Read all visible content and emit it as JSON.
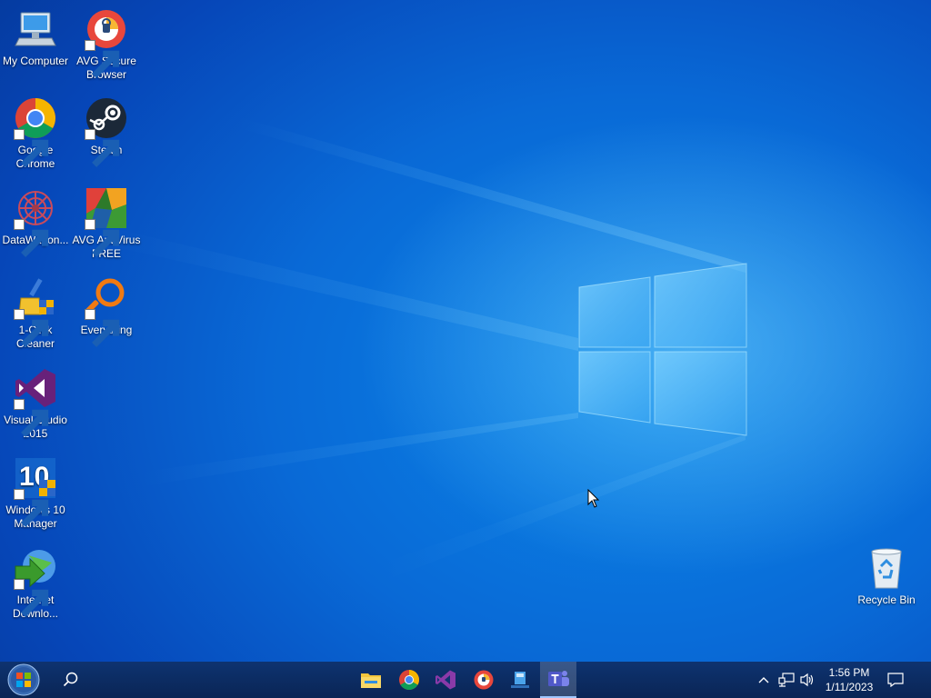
{
  "desktop": {
    "icons": [
      {
        "label": "My Computer",
        "icon": "computer-icon"
      },
      {
        "label": "AVG Secure Browser",
        "icon": "avg-secure-browser-icon"
      },
      {
        "label": "Google Chrome",
        "icon": "chrome-icon"
      },
      {
        "label": "Steam",
        "icon": "steam-icon"
      },
      {
        "label": "DataWagon...",
        "icon": "datawagon-icon"
      },
      {
        "label": "AVG AntiVirus FREE",
        "icon": "avg-antivirus-icon"
      },
      {
        "label": "1-Click Cleaner",
        "icon": "cleaner-icon"
      },
      {
        "label": "Everything",
        "icon": "everything-search-icon"
      },
      {
        "label": "Visual Studio 2015",
        "icon": "visual-studio-icon"
      },
      {
        "label": "Windows 10 Manager",
        "icon": "windows10-manager-icon"
      },
      {
        "label": "Internet Downlo...",
        "icon": "internet-download-manager-icon"
      },
      {
        "label": "Recycle Bin",
        "icon": "recycle-bin-icon"
      }
    ]
  },
  "taskbar": {
    "start": {
      "icon": "windows-start-orb-icon"
    },
    "search": {
      "icon": "search-icon"
    },
    "pinned": [
      {
        "name": "File Explorer",
        "icon": "folder-icon"
      },
      {
        "name": "Google Chrome",
        "icon": "chrome-icon"
      },
      {
        "name": "Visual Studio",
        "icon": "visual-studio-icon"
      },
      {
        "name": "AVG Secure Browser",
        "icon": "avg-secure-browser-icon"
      },
      {
        "name": "Network app",
        "icon": "network-app-icon"
      },
      {
        "name": "Microsoft Teams",
        "icon": "teams-icon"
      }
    ],
    "tray": {
      "icons": [
        "chevron-up-icon",
        "network-icon",
        "volume-icon"
      ],
      "time": "1:56 PM",
      "date": "1/11/2023",
      "notification_icon": "notification-icon"
    }
  },
  "colors": {
    "accent": "#0969d6",
    "taskbar": "#0b2a5c"
  }
}
